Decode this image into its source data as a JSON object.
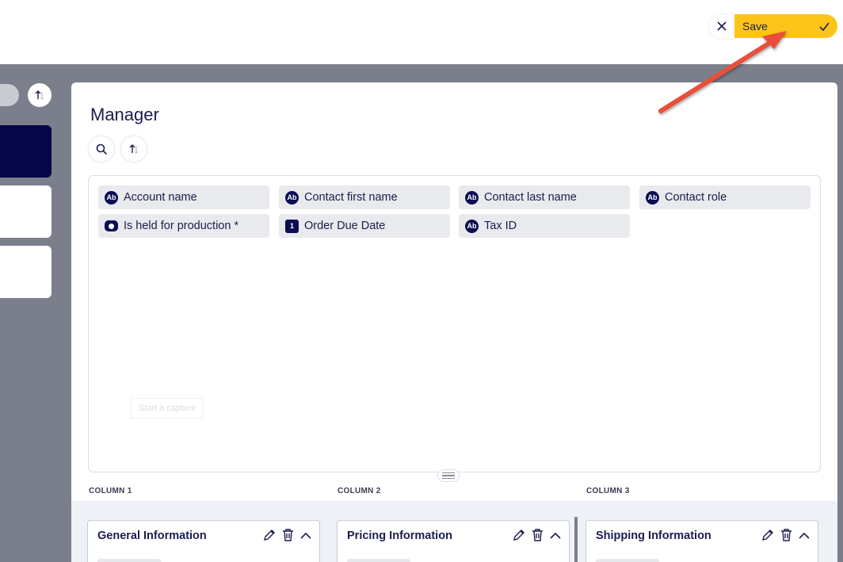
{
  "topbar": {
    "cancel_icon": "close-icon",
    "save_label": "Save",
    "save_icon": "check-icon",
    "save_color": "#fcc419"
  },
  "panel": {
    "title": "Manager",
    "search_icon": "search-icon",
    "sort_icon": "sort-icon"
  },
  "fields": [
    {
      "label": "Account name",
      "type": "text",
      "icon": "Ab"
    },
    {
      "label": "Contact first name",
      "type": "text",
      "icon": "Ab"
    },
    {
      "label": "Contact last name",
      "type": "text",
      "icon": "Ab"
    },
    {
      "label": "Contact role",
      "type": "text",
      "icon": "Ab"
    },
    {
      "label": "Is held for production *",
      "type": "toggle",
      "icon": ""
    },
    {
      "label": "Order Due Date",
      "type": "date",
      "icon": "1"
    },
    {
      "label": "Tax ID",
      "type": "text",
      "icon": "Ab"
    }
  ],
  "capture_ghost": "Start a capture",
  "columns": [
    {
      "label": "COLUMN 1",
      "section": "General Information"
    },
    {
      "label": "COLUMN 2",
      "section": "Pricing Information"
    },
    {
      "label": "COLUMN 3",
      "section": "Shipping Information"
    }
  ],
  "colors": {
    "accent_navy": "#05064a",
    "backdrop": "#7b7e8b",
    "annotation_arrow": "#e8503a"
  }
}
